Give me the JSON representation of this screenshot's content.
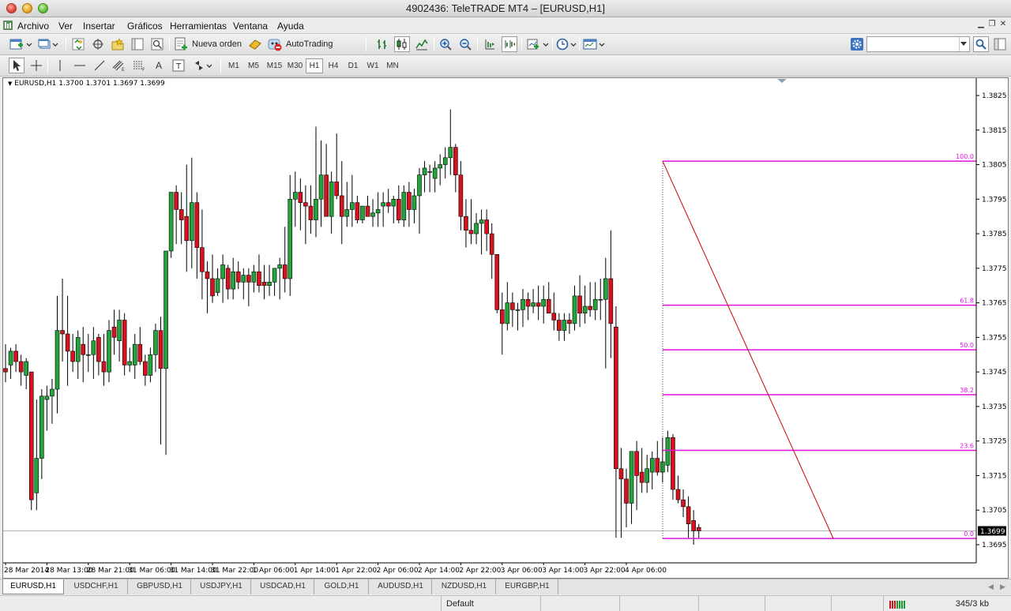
{
  "window": {
    "title": "4902436: TeleTRADE MT4 – [EURUSD,H1]"
  },
  "menu": [
    "Archivo",
    "Ver",
    "Insertar",
    "Gráficos",
    "Herramientas",
    "Ventana",
    "Ayuda"
  ],
  "toolbar": {
    "new_order_label": "Nueva orden",
    "autotrading_label": "AutoTrading",
    "search_value": ""
  },
  "timeframes": [
    "M1",
    "M5",
    "M15",
    "M30",
    "H1",
    "H4",
    "D1",
    "W1",
    "MN"
  ],
  "active_timeframe": "H1",
  "chart": {
    "header": "EURUSD,H1  1.3700 1.3701 1.3697 1.3699",
    "current_price": "1.3699",
    "price_ticks": [
      "1.3825",
      "1.3815",
      "1.3805",
      "1.3795",
      "1.3785",
      "1.3775",
      "1.3765",
      "1.3755",
      "1.3745",
      "1.3735",
      "1.3725",
      "1.3715",
      "1.3705",
      "1.3695"
    ],
    "time_ticks": [
      "28 Mar 2014",
      "28 Mar 13:00",
      "28 Mar 21:00",
      "31 Mar 06:00",
      "31 Mar 14:00",
      "31 Mar 22:00",
      "1 Apr 06:00",
      "1 Apr 14:00",
      "1 Apr 22:00",
      "2 Apr 06:00",
      "2 Apr 14:00",
      "2 Apr 22:00",
      "3 Apr 06:00",
      "3 Apr 14:00",
      "3 Apr 22:00",
      "4 Apr 06:00"
    ],
    "fib_levels": [
      {
        "label": "100.0",
        "price": 1.3806
      },
      {
        "label": "61.8",
        "price": 1.37643
      },
      {
        "label": "50.0",
        "price": 1.37514
      },
      {
        "label": "38.2",
        "price": 1.37384
      },
      {
        "label": "23.6",
        "price": 1.37223
      },
      {
        "label": "0.0",
        "price": 1.36968
      }
    ],
    "colors": {
      "bull": "#22a43a",
      "bear": "#d5121d",
      "fib": "#e010e0",
      "trend": "#cc0000"
    }
  },
  "chart_data": {
    "type": "candlestick",
    "symbol": "EURUSD",
    "timeframe": "H1",
    "ylim": [
      1.3691,
      1.3835
    ],
    "last": {
      "open": 1.37,
      "high": 1.3701,
      "low": 1.3697,
      "close": 1.3699
    },
    "candles": [
      [
        1.3746,
        1.3753,
        1.3742,
        1.3745
      ],
      [
        1.3747,
        1.3752,
        1.3743,
        1.3751
      ],
      [
        1.3751,
        1.3753,
        1.3745,
        1.3748
      ],
      [
        1.3748,
        1.375,
        1.3741,
        1.3745
      ],
      [
        1.3744,
        1.3749,
        1.374,
        1.3748
      ],
      [
        1.3745,
        1.3745,
        1.3705,
        1.3708
      ],
      [
        1.371,
        1.3737,
        1.3705,
        1.372
      ],
      [
        1.372,
        1.374,
        1.3714,
        1.3738
      ],
      [
        1.3737,
        1.3741,
        1.3728,
        1.3738
      ],
      [
        1.3738,
        1.3743,
        1.373,
        1.374
      ],
      [
        1.374,
        1.3767,
        1.3733,
        1.3757
      ],
      [
        1.3757,
        1.3772,
        1.3748,
        1.3756
      ],
      [
        1.3756,
        1.3767,
        1.3741,
        1.3751
      ],
      [
        1.3751,
        1.3756,
        1.3745,
        1.3748
      ],
      [
        1.3748,
        1.3757,
        1.3743,
        1.3755
      ],
      [
        1.3753,
        1.3758,
        1.3742,
        1.375
      ],
      [
        1.375,
        1.3756,
        1.3745,
        1.375
      ],
      [
        1.375,
        1.3758,
        1.3743,
        1.3754
      ],
      [
        1.3755,
        1.3756,
        1.3744,
        1.3748
      ],
      [
        1.3748,
        1.3756,
        1.3741,
        1.3745
      ],
      [
        1.3745,
        1.376,
        1.3742,
        1.3757
      ],
      [
        1.3758,
        1.3763,
        1.375,
        1.3755
      ],
      [
        1.3754,
        1.3763,
        1.3748,
        1.376
      ],
      [
        1.376,
        1.3762,
        1.3744,
        1.3747
      ],
      [
        1.3747,
        1.3752,
        1.3745,
        1.3748
      ],
      [
        1.3747,
        1.3756,
        1.3743,
        1.3753
      ],
      [
        1.3753,
        1.3758,
        1.3747,
        1.3748
      ],
      [
        1.3748,
        1.375,
        1.3741,
        1.3744
      ],
      [
        1.3744,
        1.3752,
        1.3742,
        1.375
      ],
      [
        1.375,
        1.3759,
        1.3745,
        1.3757
      ],
      [
        1.3757,
        1.3761,
        1.3724,
        1.3746
      ],
      [
        1.3746,
        1.377,
        1.3721,
        1.378
      ],
      [
        1.378,
        1.3793,
        1.3778,
        1.3797
      ],
      [
        1.3797,
        1.3799,
        1.3782,
        1.3792
      ],
      [
        1.3792,
        1.3797,
        1.3782,
        1.3789
      ],
      [
        1.379,
        1.3805,
        1.3774,
        1.3783
      ],
      [
        1.3783,
        1.3807,
        1.3775,
        1.3794
      ],
      [
        1.3794,
        1.3797,
        1.3772,
        1.3781
      ],
      [
        1.3781,
        1.3792,
        1.3766,
        1.3774
      ],
      [
        1.3774,
        1.3777,
        1.3762,
        1.3772
      ],
      [
        1.3772,
        1.3779,
        1.3765,
        1.3767
      ],
      [
        1.3768,
        1.3775,
        1.3767,
        1.3772
      ],
      [
        1.3772,
        1.3779,
        1.3765,
        1.3776
      ],
      [
        1.3775,
        1.3776,
        1.3766,
        1.3769
      ],
      [
        1.3769,
        1.3778,
        1.3766,
        1.3774
      ],
      [
        1.3774,
        1.3777,
        1.3769,
        1.3771
      ],
      [
        1.3771,
        1.3775,
        1.3766,
        1.3773
      ],
      [
        1.3773,
        1.3775,
        1.3764,
        1.3771
      ],
      [
        1.3771,
        1.3776,
        1.3768,
        1.3774
      ],
      [
        1.3774,
        1.3779,
        1.3768,
        1.377
      ],
      [
        1.3771,
        1.3776,
        1.3766,
        1.377
      ],
      [
        1.377,
        1.3776,
        1.3767,
        1.3771
      ],
      [
        1.3771,
        1.3774,
        1.3767,
        1.3775
      ],
      [
        1.3775,
        1.3778,
        1.3766,
        1.3776
      ],
      [
        1.3776,
        1.3787,
        1.3768,
        1.3772
      ],
      [
        1.3772,
        1.3802,
        1.3767,
        1.3795
      ],
      [
        1.3795,
        1.3803,
        1.3787,
        1.3797
      ],
      [
        1.3797,
        1.3801,
        1.3786,
        1.3794
      ],
      [
        1.3794,
        1.3799,
        1.3782,
        1.3793
      ],
      [
        1.3793,
        1.3799,
        1.3785,
        1.3789
      ],
      [
        1.3789,
        1.3816,
        1.3784,
        1.3795
      ],
      [
        1.3795,
        1.3812,
        1.3787,
        1.3802
      ],
      [
        1.3802,
        1.3811,
        1.379,
        1.379
      ],
      [
        1.379,
        1.3803,
        1.3785,
        1.38
      ],
      [
        1.38,
        1.3814,
        1.3795,
        1.3796
      ],
      [
        1.3796,
        1.3806,
        1.3782,
        1.379
      ],
      [
        1.379,
        1.38,
        1.3787,
        1.3792
      ],
      [
        1.3792,
        1.3802,
        1.3787,
        1.3794
      ],
      [
        1.3794,
        1.3796,
        1.3788,
        1.3789
      ],
      [
        1.3789,
        1.3793,
        1.3788,
        1.3793
      ],
      [
        1.3793,
        1.3796,
        1.379,
        1.379
      ],
      [
        1.379,
        1.3795,
        1.3787,
        1.3791
      ],
      [
        1.3791,
        1.3797,
        1.3787,
        1.3792
      ],
      [
        1.3793,
        1.3797,
        1.3787,
        1.3794
      ],
      [
        1.3794,
        1.3798,
        1.3791,
        1.3793
      ],
      [
        1.3793,
        1.3796,
        1.3788,
        1.3795
      ],
      [
        1.3795,
        1.3799,
        1.3788,
        1.3789
      ],
      [
        1.3789,
        1.3799,
        1.3787,
        1.3797
      ],
      [
        1.3797,
        1.38,
        1.3787,
        1.3792
      ],
      [
        1.3792,
        1.3798,
        1.3788,
        1.3796
      ],
      [
        1.3796,
        1.3804,
        1.3785,
        1.3802
      ],
      [
        1.3802,
        1.3806,
        1.3797,
        1.3804
      ],
      [
        1.3803,
        1.3805,
        1.3797,
        1.3803
      ],
      [
        1.3801,
        1.3806,
        1.3797,
        1.3804
      ],
      [
        1.3804,
        1.3808,
        1.3799,
        1.3805
      ],
      [
        1.3805,
        1.381,
        1.3801,
        1.3807
      ],
      [
        1.3807,
        1.3821,
        1.3802,
        1.381
      ],
      [
        1.381,
        1.3811,
        1.3797,
        1.3802
      ],
      [
        1.3802,
        1.3806,
        1.3786,
        1.379
      ],
      [
        1.379,
        1.3795,
        1.3781,
        1.3786
      ],
      [
        1.3786,
        1.3795,
        1.3782,
        1.3785
      ],
      [
        1.3785,
        1.3791,
        1.3782,
        1.3788
      ],
      [
        1.3788,
        1.3792,
        1.3779,
        1.3789
      ],
      [
        1.3789,
        1.3792,
        1.378,
        1.3785
      ],
      [
        1.3785,
        1.3788,
        1.3772,
        1.3779
      ],
      [
        1.3779,
        1.3779,
        1.3762,
        1.3763
      ],
      [
        1.3763,
        1.3768,
        1.375,
        1.3759
      ],
      [
        1.3759,
        1.3771,
        1.3757,
        1.3765
      ],
      [
        1.3765,
        1.3768,
        1.3758,
        1.3763
      ],
      [
        1.3763,
        1.3765,
        1.3757,
        1.3763
      ],
      [
        1.3763,
        1.3769,
        1.3758,
        1.3766
      ],
      [
        1.3766,
        1.3768,
        1.376,
        1.3764
      ],
      [
        1.3764,
        1.3769,
        1.3762,
        1.3765
      ],
      [
        1.3765,
        1.377,
        1.376,
        1.3764
      ],
      [
        1.3764,
        1.377,
        1.3759,
        1.3766
      ],
      [
        1.3766,
        1.3771,
        1.3762,
        1.3762
      ],
      [
        1.3762,
        1.3768,
        1.3757,
        1.376
      ],
      [
        1.376,
        1.3762,
        1.3754,
        1.3757
      ],
      [
        1.3757,
        1.3762,
        1.3754,
        1.376
      ],
      [
        1.376,
        1.3762,
        1.3756,
        1.3759
      ],
      [
        1.3759,
        1.377,
        1.3757,
        1.3767
      ],
      [
        1.3767,
        1.3773,
        1.3758,
        1.3762
      ],
      [
        1.3762,
        1.377,
        1.3759,
        1.3764
      ],
      [
        1.3764,
        1.3771,
        1.3761,
        1.3763
      ],
      [
        1.3763,
        1.3771,
        1.376,
        1.3766
      ],
      [
        1.3766,
        1.3772,
        1.376,
        1.3766
      ],
      [
        1.3766,
        1.3778,
        1.3746,
        1.3772
      ],
      [
        1.3772,
        1.3786,
        1.3749,
        1.3759
      ],
      [
        1.3758,
        1.3764,
        1.3697,
        1.3717
      ],
      [
        1.3717,
        1.3723,
        1.3697,
        1.3714
      ],
      [
        1.3714,
        1.3717,
        1.37,
        1.3707
      ],
      [
        1.3707,
        1.3722,
        1.3701,
        1.3722
      ],
      [
        1.3722,
        1.3725,
        1.3705,
        1.3715
      ],
      [
        1.3716,
        1.3723,
        1.371,
        1.3713
      ],
      [
        1.3713,
        1.3721,
        1.371,
        1.3717
      ],
      [
        1.3716,
        1.3722,
        1.3711,
        1.372
      ],
      [
        1.372,
        1.3725,
        1.3715,
        1.3716
      ],
      [
        1.3716,
        1.3726,
        1.3713,
        1.3719
      ],
      [
        1.3718,
        1.3728,
        1.3716,
        1.3726
      ],
      [
        1.3726,
        1.3727,
        1.3708,
        1.3711
      ],
      [
        1.3711,
        1.3715,
        1.3707,
        1.3708
      ],
      [
        1.3708,
        1.3711,
        1.3703,
        1.3706
      ],
      [
        1.3706,
        1.3709,
        1.3697,
        1.3701
      ],
      [
        1.3702,
        1.3705,
        1.3695,
        1.3699
      ],
      [
        1.37,
        1.3701,
        1.3697,
        1.3699
      ]
    ]
  },
  "tabs": [
    "EURUSD,H1",
    "USDCHF,H1",
    "GBPUSD,H1",
    "USDJPY,H1",
    "USDCAD,H1",
    "GOLD,H1",
    "AUDUSD,H1",
    "NZDUSD,H1",
    "EURGBP,H1"
  ],
  "active_tab": "EURUSD,H1",
  "status": {
    "profile": "Default",
    "traffic": "345/3 kb"
  }
}
